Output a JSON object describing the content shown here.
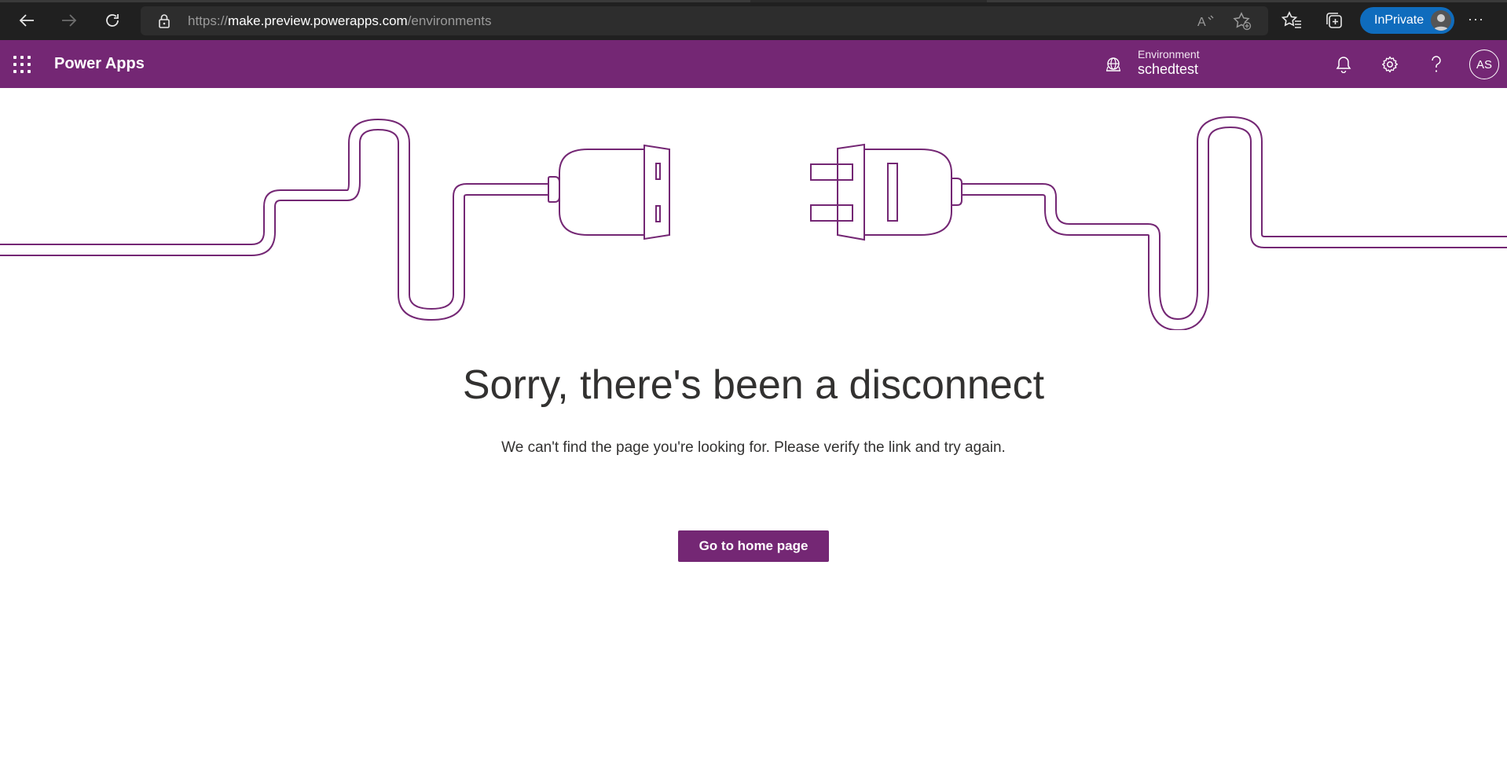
{
  "browser": {
    "url_scheme": "https://",
    "url_host": "make.preview.powerapps.com",
    "url_path": "/environments",
    "inprivate_label": "InPrivate",
    "icons": [
      "back-arrow-icon",
      "forward-arrow-icon",
      "refresh-icon",
      "lock-icon",
      "read-aloud-icon",
      "add-favorite-icon",
      "favorites-icon",
      "collections-icon",
      "more-icon"
    ]
  },
  "header": {
    "app_name": "Power Apps",
    "environment_label": "Environment",
    "environment_name": "schedtest",
    "user_initials": "AS",
    "brand_color": "#742774",
    "icons": [
      "waffle-icon",
      "environment-icon",
      "bell-icon",
      "gear-icon",
      "help-icon"
    ]
  },
  "error": {
    "title": "Sorry, there's been a disconnect",
    "message": "We can't find the page you're looking for. Please verify the link and try again.",
    "button_label": "Go to home page",
    "illustration": "unplugged-cable-illustration"
  }
}
